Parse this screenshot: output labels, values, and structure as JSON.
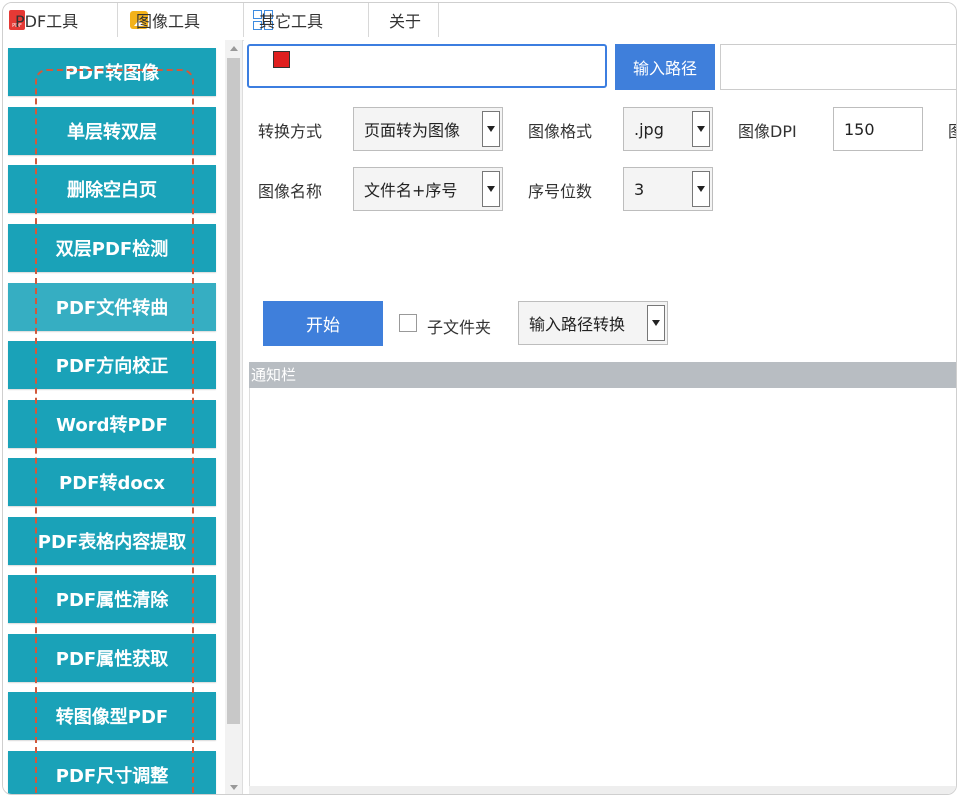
{
  "menu": {
    "tabs": [
      {
        "label": "PDF工具",
        "icon": "pdf-icon",
        "icon_text": "PDF"
      },
      {
        "label": "图像工具",
        "icon": "image-icon"
      },
      {
        "label": "其它工具",
        "icon": "grid-icon"
      },
      {
        "label": "关于"
      }
    ]
  },
  "sidebar": {
    "items": [
      {
        "label": "PDF转图像"
      },
      {
        "label": "单层转双层"
      },
      {
        "label": "删除空白页"
      },
      {
        "label": "双层PDF检测"
      },
      {
        "label": "PDF文件转曲"
      },
      {
        "label": "PDF方向校正"
      },
      {
        "label": "Word转PDF"
      },
      {
        "label": "PDF转docx"
      },
      {
        "label": "PDF表格内容提取"
      },
      {
        "label": "PDF属性清除"
      },
      {
        "label": "PDF属性获取"
      },
      {
        "label": "转图像型PDF"
      },
      {
        "label": "PDF尺寸调整"
      }
    ]
  },
  "main": {
    "path_value": "",
    "path_button": "输入路径",
    "convert_mode_label": "转换方式",
    "convert_mode_value": "页面转为图像",
    "image_format_label": "图像格式",
    "image_format_value": ".jpg",
    "image_dpi_label": "图像DPI",
    "image_dpi_value": "150",
    "cut_label": "图",
    "image_name_label": "图像名称",
    "image_name_value": "文件名+序号",
    "seq_digits_label": "序号位数",
    "seq_digits_value": "3",
    "start_button": "开始",
    "subfolder_label": "子文件夹",
    "subfolder_checked": false,
    "mode_select_value": "输入路径转换",
    "notice_title": "通知栏"
  },
  "colors": {
    "sidebar_button": "#1aa2b8",
    "primary_button": "#3f7fdb",
    "annotation_dash": "#d4583a"
  }
}
